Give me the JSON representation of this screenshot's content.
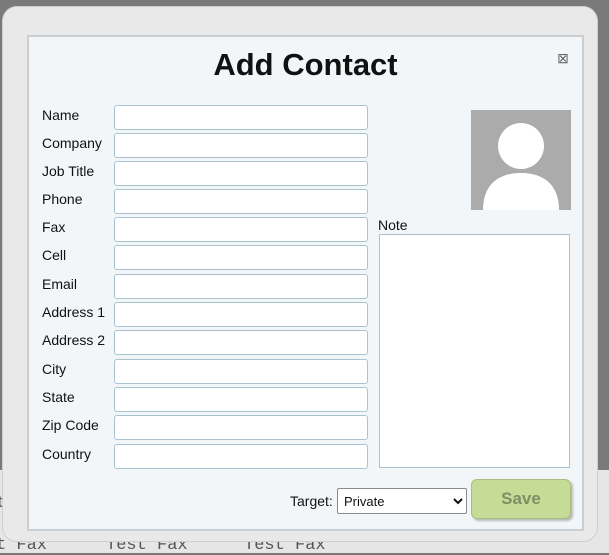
{
  "dialog": {
    "title": "Add Contact",
    "close_icon": "close-icon",
    "close_glyph": "⊠"
  },
  "fields": [
    {
      "label": "Name",
      "value": ""
    },
    {
      "label": "Company",
      "value": ""
    },
    {
      "label": "Job Title",
      "value": ""
    },
    {
      "label": "Phone",
      "value": ""
    },
    {
      "label": "Fax",
      "value": ""
    },
    {
      "label": "Cell",
      "value": ""
    },
    {
      "label": "Email",
      "value": ""
    },
    {
      "label": "Address 1",
      "value": ""
    },
    {
      "label": "Address 2",
      "value": ""
    },
    {
      "label": "City",
      "value": ""
    },
    {
      "label": "State",
      "value": ""
    },
    {
      "label": "Zip Code",
      "value": ""
    },
    {
      "label": "Country",
      "value": ""
    }
  ],
  "avatar": {
    "icon": "avatar-placeholder-icon"
  },
  "note": {
    "label": "Note",
    "value": ""
  },
  "target": {
    "label": "Target:",
    "selected": "Private"
  },
  "save": {
    "label": "Save"
  },
  "background": {
    "row1": "t",
    "row2": [
      "t Fax",
      "Test Fax",
      "Test Fax"
    ]
  },
  "colors": {
    "save_bg": "#c6dc96",
    "input_border": "#a9c3d1",
    "dialog_bg": "#f2f6f8"
  }
}
